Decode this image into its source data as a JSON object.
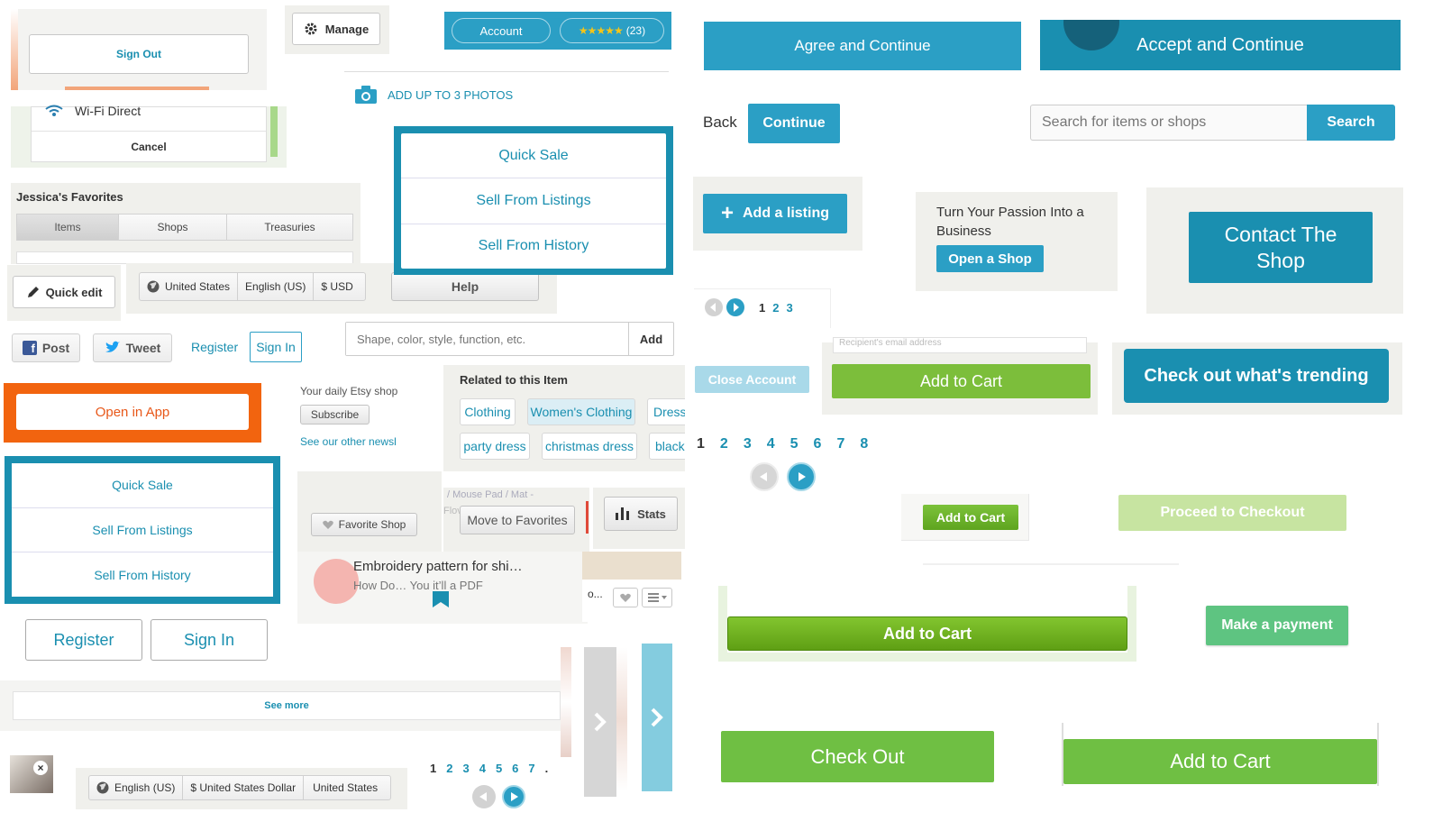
{
  "signout": {
    "label": "Sign Out"
  },
  "wifi": {
    "label": "Wi-Fi Direct",
    "cancel": "Cancel"
  },
  "manage": {
    "label": "Manage"
  },
  "account": {
    "label": "Account",
    "stars": "★★★★★",
    "count": "(23)"
  },
  "photos": {
    "label": "ADD UP TO 3 PHOTOS"
  },
  "sell_menu": {
    "quick_sale": "Quick Sale",
    "from_listings": "Sell From Listings",
    "from_history": "Sell From History"
  },
  "favorites": {
    "title": "Jessica's Favorites",
    "tabs": [
      "Items",
      "Shops",
      "Treasuries"
    ]
  },
  "quick_edit": {
    "label": "Quick edit"
  },
  "locale": {
    "country": "United States",
    "language": "English (US)",
    "currency": "$ USD",
    "help": "Help"
  },
  "social": {
    "post": "Post",
    "tweet": "Tweet",
    "register": "Register",
    "sign_in": "Sign In"
  },
  "tag_input": {
    "placeholder": "Shape, color, style, function, etc.",
    "add": "Add"
  },
  "open_app": {
    "label": "Open in App"
  },
  "daily": {
    "title": "Your daily Etsy shop",
    "subscribe": "Subscribe",
    "other": "See our other newsl"
  },
  "related": {
    "title": "Related to this Item",
    "tags": [
      "Clothing",
      "Women's Clothing",
      "Dress",
      "party dress",
      "christmas dress",
      "black"
    ]
  },
  "sell_menu2": {
    "quick_sale": "Quick Sale",
    "from_listings": "Sell From Listings",
    "from_history": "Sell From History"
  },
  "favorite_shop": {
    "label": "Favorite Shop"
  },
  "listing": {
    "crumb": "/ Mouse Pad / Mat -",
    "flow": "Flov",
    "move": "Move to Favorites",
    "stats": "Stats",
    "pattern": "Embroidery pattern for shi…",
    "sub": "How Do…  You it’ll a PDF",
    "ellipsis": "o..."
  },
  "auth": {
    "register": "Register",
    "sign_in": "Sign In"
  },
  "see_more": {
    "label": "See more"
  },
  "locale2": {
    "language": "English (US)",
    "currency": "$ United States Dollar",
    "country": "United States"
  },
  "pager_small": {
    "pages": [
      "1",
      "2",
      "3",
      "4",
      "5",
      "6",
      "7"
    ],
    "dot": "."
  },
  "agree": {
    "label": "Agree and Continue"
  },
  "accept": {
    "label": "Accept and Continue"
  },
  "back_continue": {
    "back": "Back",
    "continue": "Continue"
  },
  "search": {
    "placeholder": "Search for items or shops",
    "button": "Search"
  },
  "add_listing": {
    "label": "Add a listing"
  },
  "passion": {
    "text": "Turn Your Passion Into a Business",
    "button": "Open a Shop"
  },
  "contact": {
    "label": "Contact The Shop"
  },
  "pager_mini": {
    "pages": [
      "1",
      "2",
      "3"
    ]
  },
  "close_account": {
    "label": "Close Account"
  },
  "recipient": {
    "placeholder": "Recipient's email address"
  },
  "add_to_cart_labels": {
    "a": "Add to Cart",
    "b": "Add to Cart",
    "c": "Add to Cart",
    "d": "Add to Cart"
  },
  "trending": {
    "label": "Check out what's trending"
  },
  "pager_big": {
    "pages": [
      "1",
      "2",
      "3",
      "4",
      "5",
      "6",
      "7",
      "8"
    ]
  },
  "checkout": {
    "proceed": "Proceed to Checkout",
    "payment": "Make a payment",
    "check_out": "Check Out"
  },
  "colors": {
    "teal": "#2b9fc5",
    "green": "#7cbe3b",
    "orange": "#f2640f",
    "fb": "#3b5998",
    "twitter": "#1da1f2"
  }
}
